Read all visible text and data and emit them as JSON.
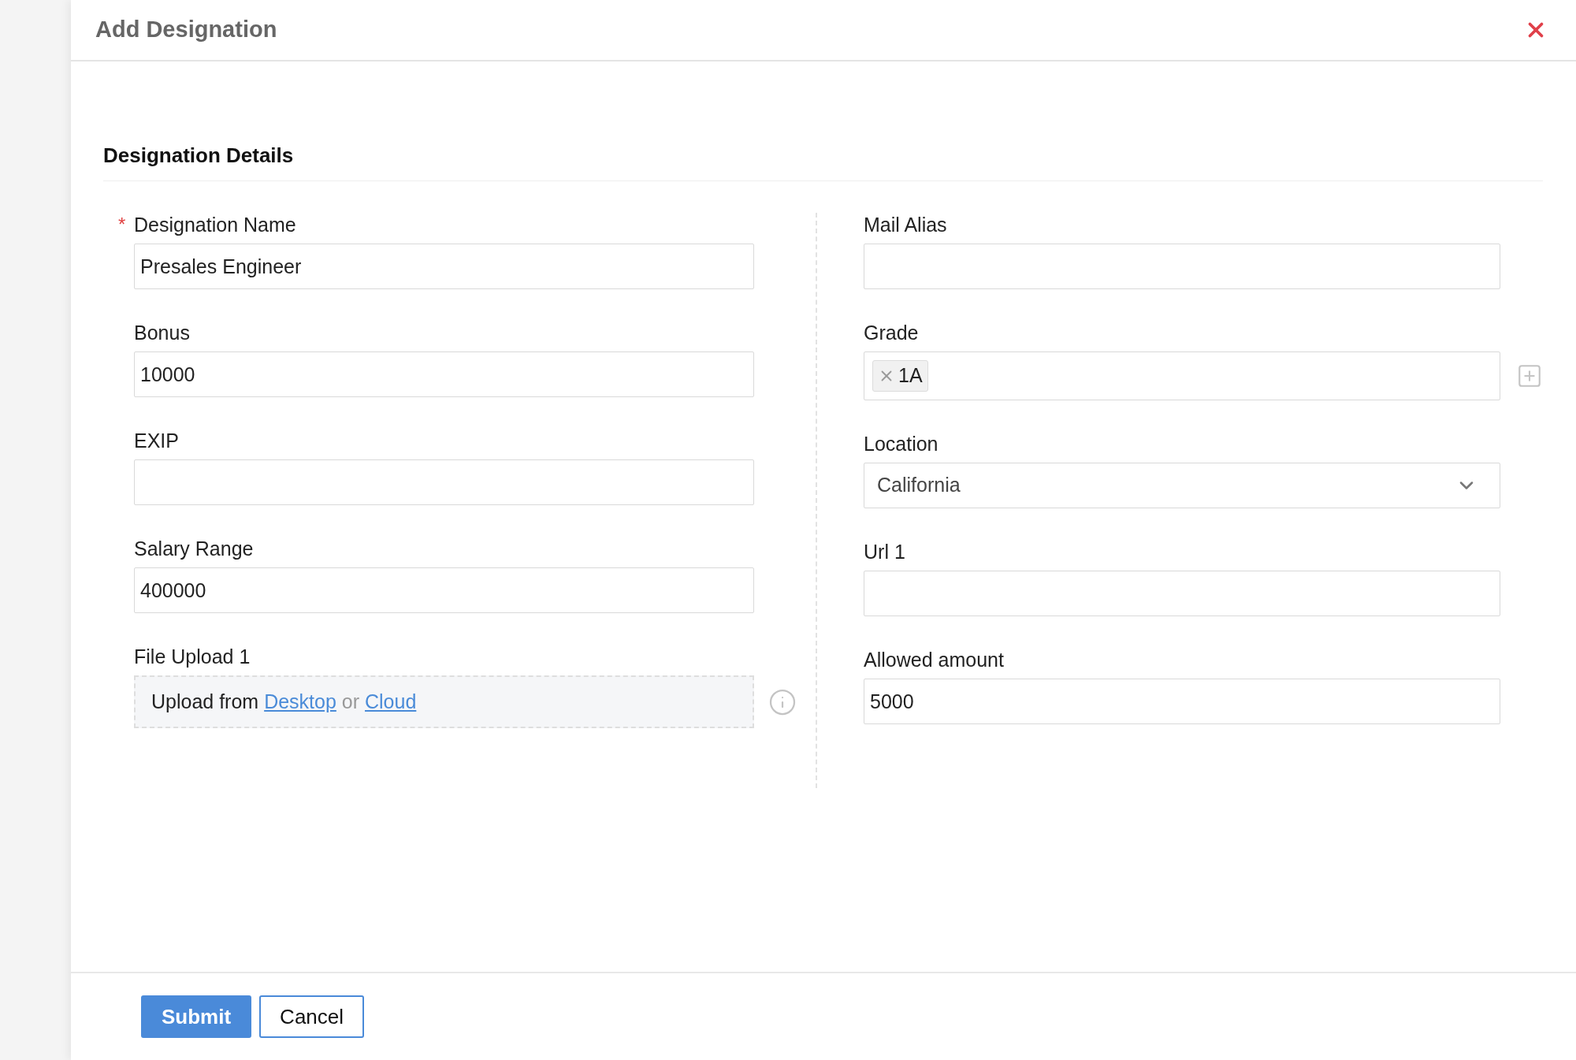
{
  "dialog": {
    "title": "Add Designation",
    "section_title": "Designation Details",
    "left_fields": [
      {
        "kind": "text",
        "label": "Designation Name",
        "required_mark": "*",
        "value": "Presales Engineer"
      },
      {
        "kind": "text",
        "label": "Bonus",
        "value": "10000"
      },
      {
        "kind": "text",
        "label": "EXIP"
      },
      {
        "kind": "text",
        "label": "Salary Range",
        "value": "400000"
      },
      {
        "kind": "upload",
        "label": "File Upload 1",
        "prefix": "Upload from",
        "links": [
          "Desktop",
          "Cloud"
        ],
        "separator": "or"
      }
    ],
    "right_fields": [
      {
        "kind": "text",
        "label": "Mail Alias"
      },
      {
        "kind": "tags",
        "label": "Grade",
        "tags": [
          "1A"
        ]
      },
      {
        "kind": "select",
        "label": "Location",
        "value": "California"
      },
      {
        "kind": "text",
        "label": "Url 1"
      },
      {
        "kind": "text",
        "label": "Allowed amount",
        "value": "5000"
      }
    ],
    "buttons": [
      {
        "label": "Submit",
        "kind": "primary"
      },
      {
        "label": "Cancel",
        "kind": "secondary"
      }
    ]
  }
}
